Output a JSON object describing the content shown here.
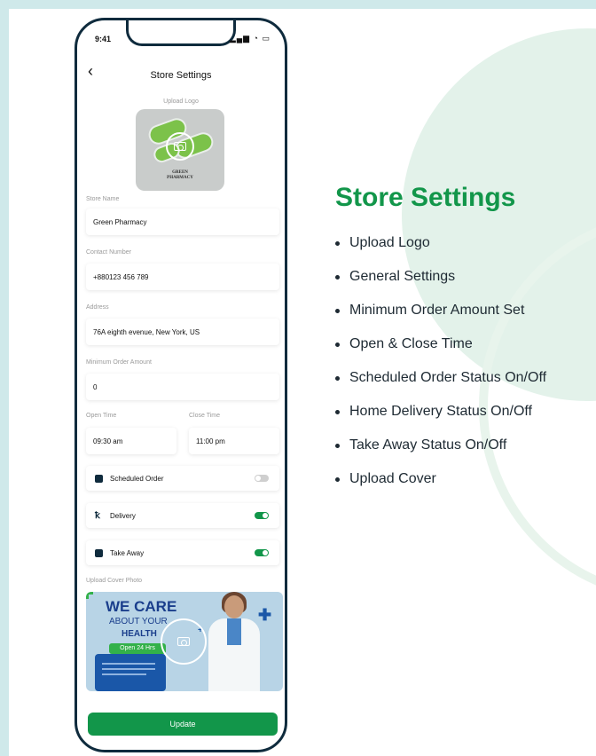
{
  "status_bar": {
    "time": "9:41",
    "icons": "signal-wifi-battery"
  },
  "header": {
    "back_icon": "chevron-left-icon",
    "title": "Store Settings"
  },
  "logo": {
    "label": "Upload Logo",
    "brand_line1": "GREEN",
    "brand_line2": "PHARMACY",
    "icon": "camera-icon"
  },
  "fields": {
    "store_name": {
      "label": "Store Name",
      "value": "Green Pharmacy"
    },
    "contact_number": {
      "label": "Contact Number",
      "value": "+880123 456 789"
    },
    "address": {
      "label": "Address",
      "value": "76A eighth evenue, New York, US"
    },
    "minimum_order": {
      "label": "Minimum Order Amount",
      "value": "0"
    },
    "open_time": {
      "label": "Open Time",
      "value": "09:30 am"
    },
    "close_time": {
      "label": "Close Time",
      "value": "11:00 pm"
    }
  },
  "toggles": [
    {
      "label": "Scheduled Order",
      "icon": "calendar-icon",
      "on": false
    },
    {
      "label": "Delivery",
      "icon": "delivery-person-icon",
      "on": true
    },
    {
      "label": "Take Away",
      "icon": "bag-icon",
      "on": true
    }
  ],
  "cover": {
    "label": "Upload Cover Photo",
    "headline": "WE CARE",
    "sub1": "ABOUT YOUR",
    "sub2": "HEALTH",
    "badge": "Open 24 Hrs"
  },
  "update_button": "Update",
  "feature_panel": {
    "title": "Store Settings",
    "items": [
      "Upload Logo",
      "General Settings",
      "Minimum Order Amount Set",
      "Open & Close Time",
      "Scheduled Order Status On/Off",
      "Home Delivery Status On/Off",
      "Take Away Status On/Off",
      "Upload Cover"
    ]
  },
  "colors": {
    "accent": "#12964a",
    "frame": "#0f2b3d",
    "background": "#cfe9ea"
  }
}
